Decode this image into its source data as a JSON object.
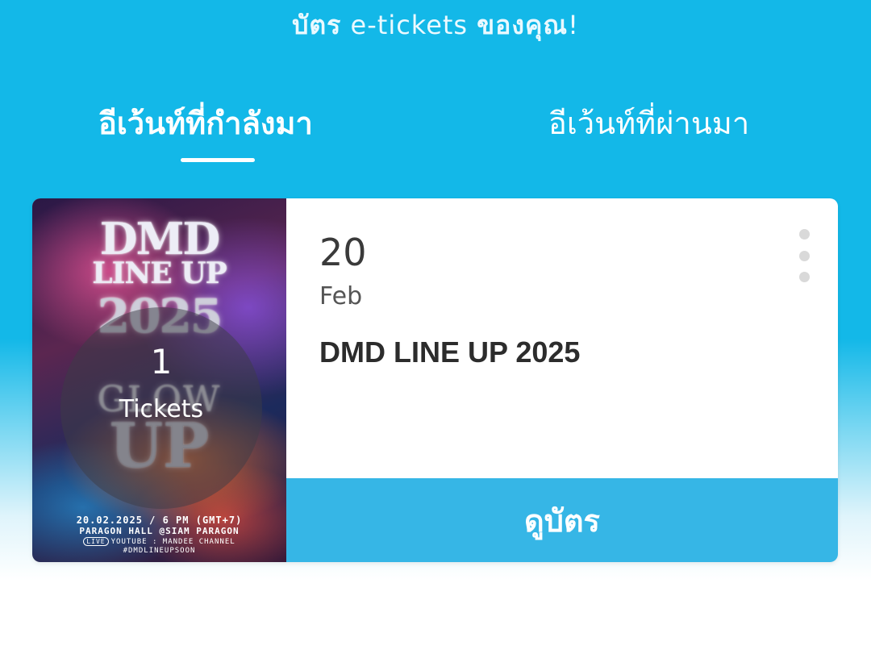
{
  "header": {
    "title_pre": "บัตร",
    "title_mid": " e-tickets ",
    "title_post": "ของคุณ",
    "title_end": "!"
  },
  "tabs": [
    {
      "label": "อีเว้นท์ที่กำลังมา",
      "active": true
    },
    {
      "label": "อีเว้นท์ที่ผ่านมา",
      "active": false
    }
  ],
  "colors": {
    "background": "#13b8e8",
    "button": "#36b6e6",
    "card": "#ffffff"
  },
  "event": {
    "day": "20",
    "month": "Feb",
    "title": "DMD LINE UP 2025",
    "ticket_count": "1",
    "ticket_label": "Tickets",
    "view_button_label": "ดูบัตร",
    "menu_icon": "more-vertical-icon",
    "poster": {
      "line1": "DMD",
      "line2": "LINE UP",
      "line3": "2025",
      "line4": "GLOW",
      "line5": "UP",
      "date_time": "20.02.2025 / 6 PM (GMT+7)",
      "venue": "PARAGON HALL @SIAM PARAGON",
      "live_badge": "LIVE",
      "stream": "YOUTUBE : MANDEE CHANNEL",
      "hashtag": "#DMDLINEUPSOON"
    }
  }
}
